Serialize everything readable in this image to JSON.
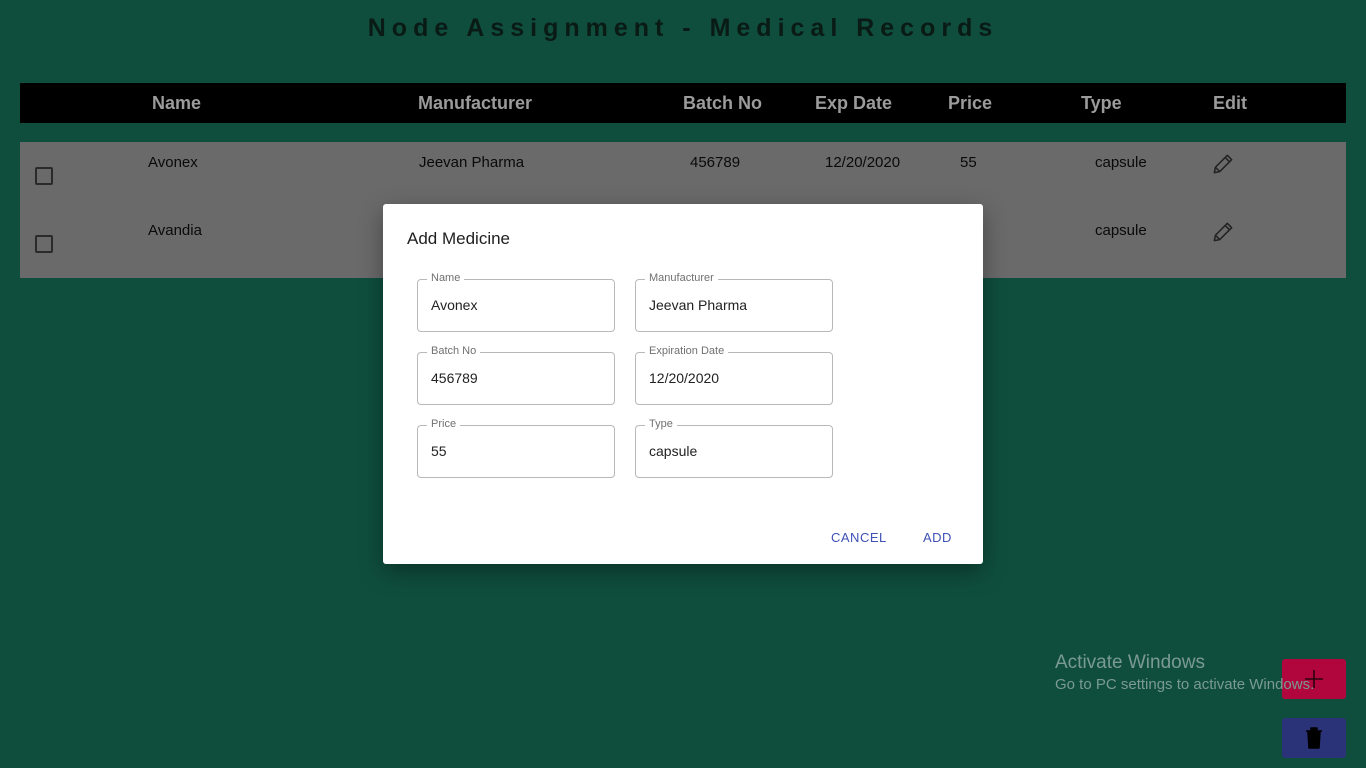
{
  "page": {
    "title": "Node Assignment - Medical Records"
  },
  "table": {
    "headers": [
      "Name",
      "Manufacturer",
      "Batch No",
      "Exp Date",
      "Price",
      "Type",
      "Edit"
    ],
    "rows": [
      {
        "name": "Avonex",
        "manufacturer": "Jeevan Pharma",
        "batch": "456789",
        "exp": "12/20/2020",
        "price": "55",
        "type": "capsule"
      },
      {
        "name": "Avandia",
        "manufacturer": "",
        "batch": "",
        "exp": "",
        "price": "",
        "type": "capsule"
      }
    ]
  },
  "dialog": {
    "title": "Add Medicine",
    "fields": {
      "name": {
        "label": "Name",
        "value": "Avonex"
      },
      "manufacturer": {
        "label": "Manufacturer",
        "value": "Jeevan Pharma"
      },
      "batch": {
        "label": "Batch No",
        "value": "456789"
      },
      "exp": {
        "label": "Expiration Date",
        "value": "12/20/2020"
      },
      "price": {
        "label": "Price",
        "value": "55"
      },
      "type": {
        "label": "Type",
        "value": "capsule"
      }
    },
    "cancel_label": "CANCEL",
    "add_label": "ADD"
  },
  "watermark": {
    "line1": "Activate Windows",
    "line2": "Go to PC settings to activate Windows."
  },
  "colors": {
    "background": "#0f4e3d",
    "add_fab": "#b0063d",
    "delete_fab": "#2a3278",
    "accent": "#3f51b5"
  },
  "icons": {
    "edit": "pencil-icon",
    "add": "plus-icon",
    "delete": "trash-icon"
  }
}
